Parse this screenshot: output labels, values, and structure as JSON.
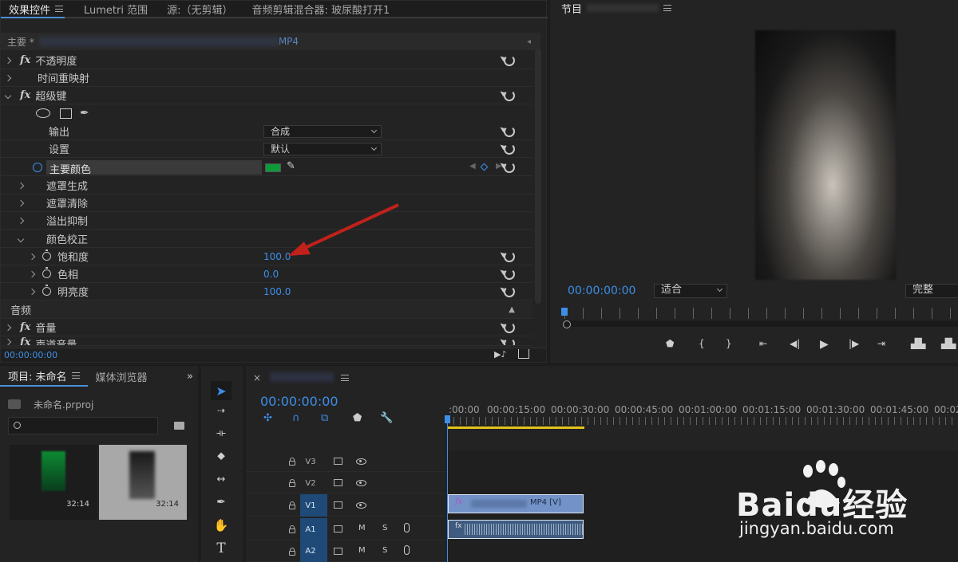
{
  "effect_controls": {
    "tabs": [
      {
        "label": "效果控件",
        "active": true
      },
      {
        "label": "Lumetri 范围"
      },
      {
        "label": "源:（无剪辑）"
      },
      {
        "label": "音频剪辑混合器: 玻尿酸打开1"
      }
    ],
    "clip_header": {
      "master": "主要 *",
      "clip_suffix": "MP4"
    },
    "effects": [
      {
        "label": "不透明度"
      },
      {
        "label": "时间重映射"
      },
      {
        "label": "超级键"
      }
    ],
    "output_label": "输出",
    "output_value": "合成",
    "settings_label": "设置",
    "settings_value": "默认",
    "key_color_label": "主要颜色",
    "key_color": "#0d9a3a",
    "subgroups": [
      "遮罩生成",
      "遮罩清除",
      "溢出抑制",
      "颜色校正"
    ],
    "color_correction": [
      {
        "label": "饱和度",
        "value": "100.0"
      },
      {
        "label": "色相",
        "value": "0.0"
      },
      {
        "label": "明亮度",
        "value": "100.0"
      }
    ],
    "audio_section": "音频",
    "volume_label": "音量",
    "channel_volume_label": "声道音量",
    "timecode": "00:00:00:00"
  },
  "program_monitor": {
    "title": "节目",
    "timecode": "00:00:00:00",
    "fit": "适合",
    "quality": "完整"
  },
  "project": {
    "tabs": [
      {
        "label": "项目: 未命名",
        "active": true
      },
      {
        "label": "媒体浏览器"
      }
    ],
    "file": "未命名.prproj",
    "items": [
      {
        "duration": "32:14"
      },
      {
        "duration": "32:14"
      }
    ]
  },
  "timeline": {
    "timecode": "00:00:00:00",
    "ruler": [
      ":00:00",
      "00:00:15:00",
      "00:00:30:00",
      "00:00:45:00",
      "00:01:00:00",
      "00:01:15:00",
      "00:01:30:00",
      "00:01:45:00",
      "00:02"
    ],
    "tracks": [
      {
        "name": "V3",
        "type": "video"
      },
      {
        "name": "V2",
        "type": "video"
      },
      {
        "name": "V1",
        "type": "video",
        "target": true
      },
      {
        "name": "A1",
        "type": "audio",
        "target": true
      },
      {
        "name": "A2",
        "type": "audio",
        "target": true
      }
    ],
    "clip_label": "MP4 [V]",
    "mute": "M",
    "solo": "S"
  },
  "watermark": {
    "brand": "Baidu经验",
    "url": "jingyan.baidu.com"
  }
}
